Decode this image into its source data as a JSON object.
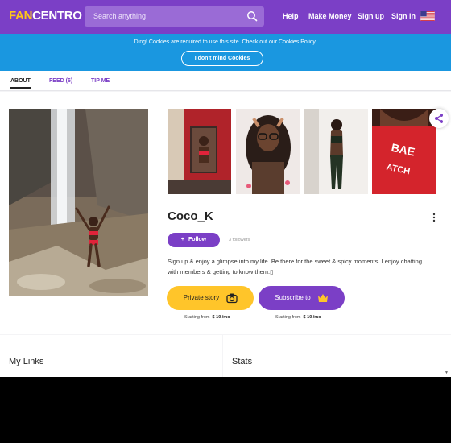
{
  "header": {
    "logo_fan": "FAN",
    "logo_centro": "CENTRO",
    "search_placeholder": "Search anything",
    "nav": [
      "Help",
      "Make Money",
      "Sign up",
      "Sign in"
    ]
  },
  "cookie": {
    "message": "Ding! Cookies are required to use this site. Check out our Cookies Policy.",
    "button": "I don't mind Cookies"
  },
  "tabs": [
    {
      "label": "ABOUT",
      "active": true
    },
    {
      "label": "FEED (6)",
      "active": false
    },
    {
      "label": "TIP ME",
      "active": false
    }
  ],
  "profile": {
    "name": "Coco_K",
    "follow_label": "Follow",
    "followers_text": "3 followers",
    "bio": "Sign up & enjoy a glimpse into my life. Be there for the sweet & spicy moments. I enjoy chatting with members & getting to know them.▯",
    "private_story_label": "Private story",
    "subscribe_label": "Subscribe to",
    "starting_from": "Starting from",
    "private_price": "$ 10 /mo",
    "subscribe_price": "$ 10 /mo",
    "thumb4_text": "BAE WATCH"
  },
  "sections": {
    "links_title": "My Links",
    "stats_title": "Stats"
  },
  "colors": {
    "brand_purple": "#7b3fc6",
    "brand_yellow": "#ffc52a",
    "cookie_blue": "#1a97e0"
  }
}
